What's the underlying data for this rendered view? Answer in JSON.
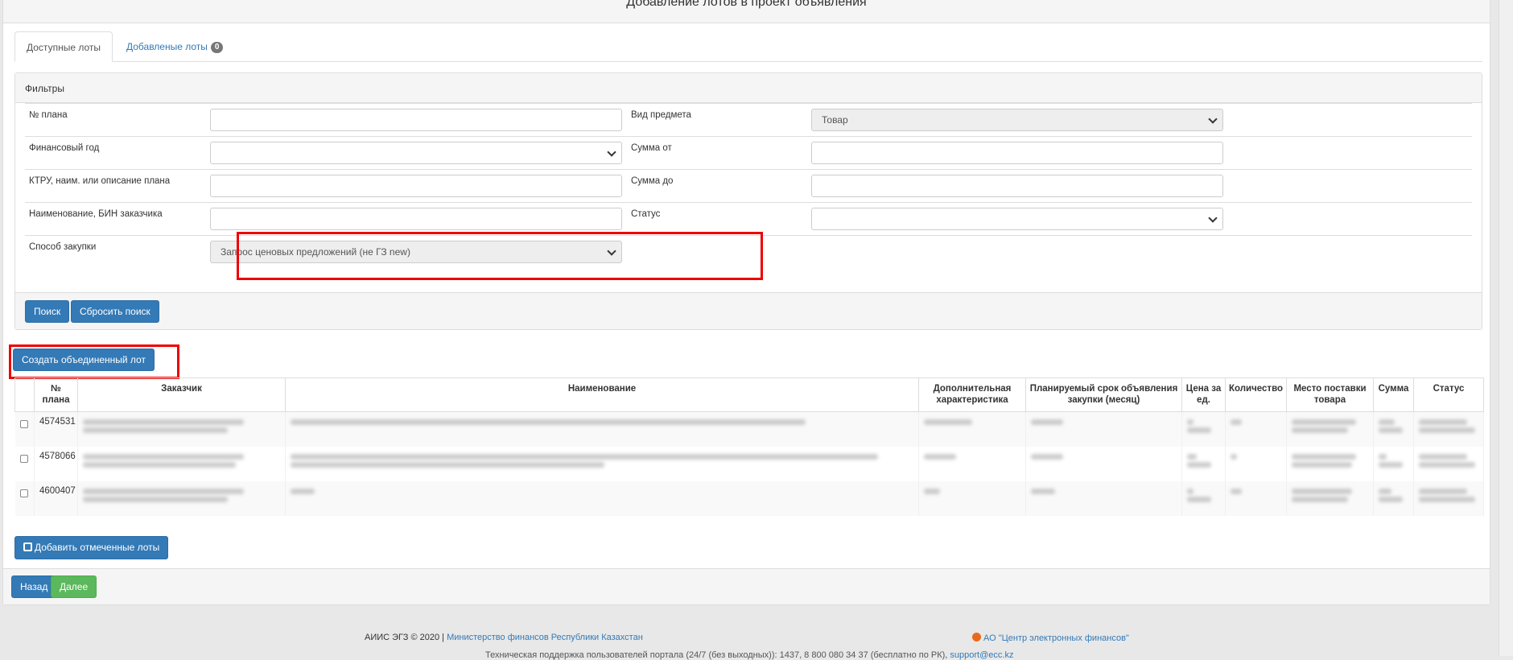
{
  "page": {
    "title": "Добавление лотов в проект объявления"
  },
  "tabs": [
    {
      "label": "Доступные лоты",
      "active": true
    },
    {
      "label": "Добавленые лоты",
      "badge": "0",
      "active": false
    }
  ],
  "filters": {
    "heading": "Фильтры",
    "left": [
      {
        "label": "№ плана",
        "value": ""
      },
      {
        "label": "Финансовый год",
        "value": "",
        "select": true
      },
      {
        "label": "КТРУ, наим. или описание плана",
        "value": ""
      },
      {
        "label": "Наименование, БИН заказчика",
        "value": ""
      },
      {
        "label": "Способ закупки",
        "value": "Запрос ценовых предложений (не ГЗ new)",
        "select": true,
        "disabled": true
      }
    ],
    "right": [
      {
        "label": "Вид предмета",
        "value": "Товар",
        "select": true,
        "disabled": true
      },
      {
        "label": "Сумма от",
        "value": ""
      },
      {
        "label": "Сумма до",
        "value": ""
      },
      {
        "label": "Статус",
        "value": "",
        "select": true
      }
    ],
    "search_label": "Поиск",
    "reset_label": "Сбросить поиск"
  },
  "create_combined_lot_label": "Создать объединенный лот",
  "table": {
    "columns": [
      "",
      "№ плана",
      "Заказчик",
      "Наименование",
      "Дополнительная характеристика",
      "Планируемый срок объявления закупки (месяц)",
      "Цена за ед.",
      "Количество",
      "Место поставки товара",
      "Сумма",
      "Статус"
    ],
    "rows": [
      {
        "plan": "4574531"
      },
      {
        "plan": "4578066"
      },
      {
        "plan": "4600407"
      }
    ]
  },
  "add_checked_label": "Добавить отмеченные лоты",
  "back_label": "Назад",
  "next_label": "Далее",
  "footer": {
    "copyright": "АИИС ЭГЗ © 2020 |",
    "ministry": "Министерство финансов Республики Казахстан",
    "center": "АО \"Центр электронных финансов\"",
    "support": "Техническая поддержка пользователей портала (24/7 (без выходных)): 1437, 8 800 080 34 37 (бесплатно по РК)",
    "support_email": "support@ecc.kz"
  },
  "colors": {
    "primary": "#337ab7",
    "success": "#5cb85c",
    "highlight": "#ee0000"
  }
}
